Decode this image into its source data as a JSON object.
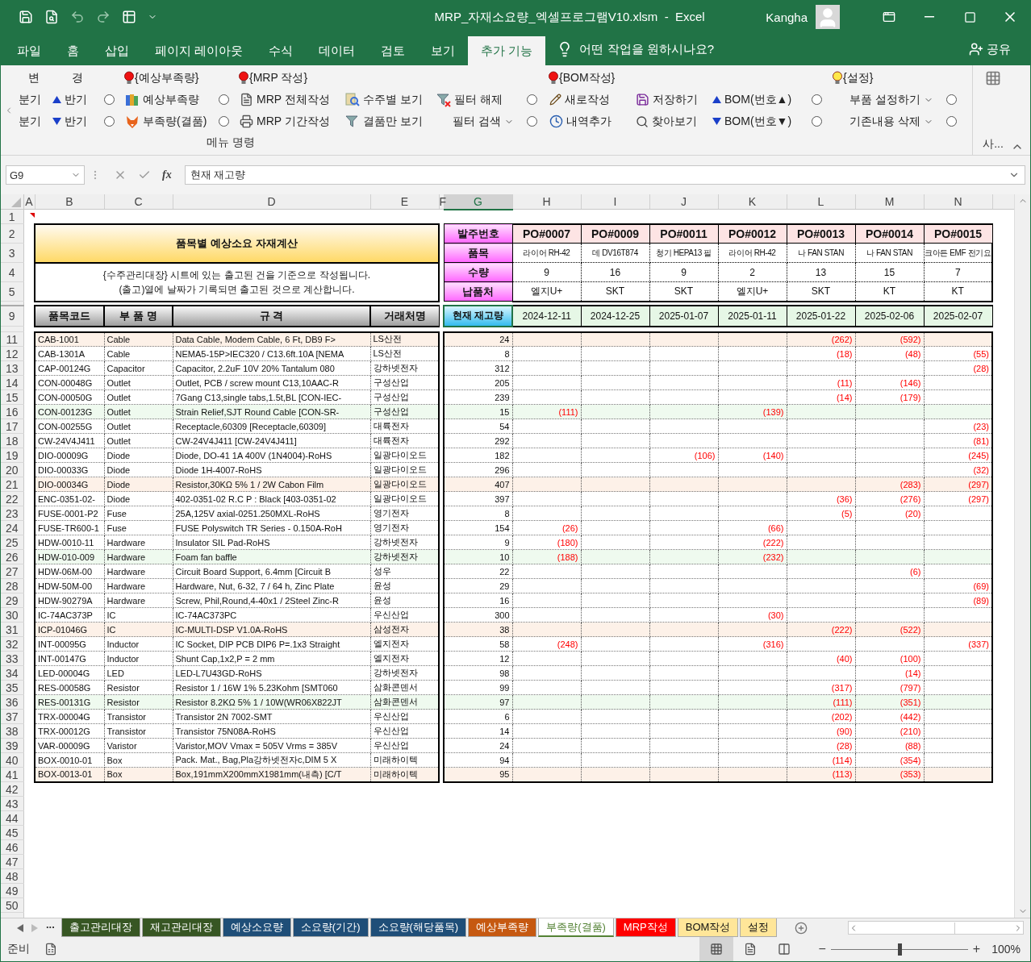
{
  "window": {
    "title": "MRP_자재소요량_엑셀프로그램V10.xlsm  -  Excel",
    "user": "Kangha"
  },
  "menu_tabs": [
    {
      "label": "파일",
      "selected": false
    },
    {
      "label": "홈",
      "selected": false
    },
    {
      "label": "삽입",
      "selected": false
    },
    {
      "label": "페이지 레이아웃",
      "selected": false
    },
    {
      "label": "수식",
      "selected": false
    },
    {
      "label": "데이터",
      "selected": false
    },
    {
      "label": "검토",
      "selected": false
    },
    {
      "label": "보기",
      "selected": false
    },
    {
      "label": "추가 기능",
      "selected": true
    }
  ],
  "tell_me": "어떤 작업을 원하시나요?",
  "share": "공유",
  "ribbon": {
    "columns": [
      {
        "header": {
          "label": "변",
          "kind": "plain"
        },
        "buttons": [
          {
            "label": "분기",
            "kind": "plain"
          },
          {
            "label": "분기",
            "kind": "plain"
          }
        ]
      },
      {
        "header": {
          "label": "경",
          "kind": "plain"
        },
        "buttons": [
          {
            "label": "반기",
            "kind": "up"
          },
          {
            "label": "반기",
            "kind": "down"
          }
        ]
      },
      {
        "buttons": [
          {
            "kind": "radio",
            "checked": false
          },
          {
            "kind": "radio",
            "checked": false
          }
        ]
      },
      {
        "header": {
          "label": "{예상부족량}",
          "kind": "bulb-red"
        },
        "buttons": [
          {
            "label": "예상부족량",
            "kind": "books"
          },
          {
            "label": "부족량(결품)",
            "kind": "fox"
          }
        ]
      },
      {
        "buttons": [
          {
            "kind": "radio",
            "checked": false
          },
          {
            "kind": "radio",
            "checked": false
          }
        ]
      },
      {
        "header": {
          "label": "{MRP 작성}",
          "kind": "bulb-red"
        },
        "buttons": [
          {
            "label": "MRP 전체작성",
            "kind": "doc"
          },
          {
            "label": "MRP 기간작성",
            "kind": "print"
          }
        ]
      },
      {
        "buttons": [
          {
            "label": "수주별 보기",
            "kind": "find"
          },
          {
            "label": "결품만 보기",
            "kind": "filter"
          }
        ]
      },
      {
        "buttons": [
          {
            "label": "필터 해제",
            "kind": "filter-x"
          },
          {
            "label": "필터 검색",
            "kind": "dropdown"
          }
        ]
      },
      {
        "buttons": [
          {
            "kind": "radio",
            "checked": false
          },
          {
            "kind": "radio",
            "checked": false
          }
        ]
      },
      {
        "header": {
          "label": "{BOM작성}",
          "kind": "bulb-red"
        },
        "buttons": [
          {
            "label": "새로작성",
            "kind": "pencil"
          },
          {
            "label": "내역추가",
            "kind": "clock"
          }
        ]
      },
      {
        "buttons": [
          {
            "label": "저장하기",
            "kind": "save"
          },
          {
            "label": "찾아보기",
            "kind": "search"
          }
        ]
      },
      {
        "buttons": [
          {
            "label": "BOM(번호▲)",
            "kind": "up"
          },
          {
            "label": "BOM(번호▼)",
            "kind": "down"
          }
        ]
      },
      {
        "buttons": [
          {
            "kind": "radio",
            "checked": false
          },
          {
            "kind": "radio",
            "checked": false
          }
        ]
      },
      {
        "header": {
          "label": "{설정}",
          "kind": "bulb-yellow"
        },
        "buttons": [
          {
            "label": "부품 설정하기",
            "kind": "dropdown"
          },
          {
            "label": "기존내용 삭제",
            "kind": "dropdown"
          }
        ]
      },
      {
        "buttons": [
          {
            "kind": "radio",
            "checked": false
          },
          {
            "kind": "radio",
            "checked": false
          }
        ]
      }
    ],
    "group_label": "메뉴 명령",
    "side_label": "사..."
  },
  "formula_bar": {
    "name_box": "G9",
    "fx": "fx",
    "value": "현재 재고량"
  },
  "column_headers": [
    {
      "label": "A",
      "selected": false
    },
    {
      "label": "B",
      "selected": false
    },
    {
      "label": "C",
      "selected": false
    },
    {
      "label": "D",
      "selected": false
    },
    {
      "label": "E",
      "selected": false
    },
    {
      "label": "F",
      "selected": false
    },
    {
      "label": "G",
      "selected": true
    },
    {
      "label": "H",
      "selected": false
    },
    {
      "label": "I",
      "selected": false
    },
    {
      "label": "J",
      "selected": false
    },
    {
      "label": "K",
      "selected": false
    },
    {
      "label": "L",
      "selected": false
    },
    {
      "label": "M",
      "selected": false
    },
    {
      "label": "N",
      "selected": false
    }
  ],
  "row_numbers": [
    "1",
    "2",
    "3",
    "4",
    "5",
    "9",
    "11",
    "12",
    "13",
    "14",
    "15",
    "16",
    "17",
    "18",
    "19",
    "20",
    "21",
    "22",
    "23",
    "24",
    "25",
    "26",
    "27",
    "28",
    "29",
    "30",
    "31",
    "32",
    "33",
    "34",
    "35",
    "36",
    "37",
    "38",
    "39",
    "40",
    "41",
    "42",
    "43",
    "44",
    "45",
    "46",
    "47",
    "48",
    "49",
    "50"
  ],
  "sheet": {
    "title": "품목별 예상소요 자재계산",
    "notes": [
      "{수주관리대장} 시트에 있는 출고된 건을 기준으로 작성됩니다.",
      "(출고)열에 날짜가 기록되면 출고된 것으로 계산합니다."
    ],
    "order_labels": [
      "발주번호",
      "품목",
      "수량",
      "납품처"
    ],
    "orders": [
      {
        "po": "PO#0007",
        "item": "라이어 RH-42",
        "qty": "9",
        "vendor": "엘지U+",
        "date": "2024-12-11"
      },
      {
        "po": "PO#0009",
        "item": "데 DV16T874",
        "qty": "16",
        "vendor": "SKT",
        "date": "2024-12-25"
      },
      {
        "po": "PO#0011",
        "item": "청기 HEPA13 필",
        "qty": "9",
        "vendor": "SKT",
        "date": "2025-01-07"
      },
      {
        "po": "PO#0012",
        "item": "라이어 RH-42",
        "qty": "2",
        "vendor": "엘지U+",
        "date": "2025-01-11"
      },
      {
        "po": "PO#0013",
        "item": "나 FAN STAN",
        "qty": "13",
        "vendor": "SKT",
        "date": "2025-01-22"
      },
      {
        "po": "PO#0014",
        "item": "나 FAN STAN",
        "qty": "15",
        "vendor": "KT",
        "date": "2025-02-06"
      },
      {
        "po": "PO#0015",
        "item": "크아든 EMF 전기요",
        "qty": "7",
        "vendor": "KT",
        "date": "2025-02-07"
      }
    ],
    "headers": [
      "품목코드",
      "부 품 명",
      "규  격",
      "거래처명"
    ],
    "stock_header": "현재 재고량",
    "rows": [
      {
        "code": "CAB-1001",
        "name": "Cable",
        "spec": "Data Cable, Modem Cable, 6 Ft, DB9 F>",
        "vendor": "LS산전",
        "stock": "24",
        "shortages": {
          "L": "(262)",
          "M": "(592)"
        }
      },
      {
        "code": "CAB-1301A",
        "name": "Cable",
        "spec": "NEMA5-15P>IEC320 / C13.6ft.10A [NEMA",
        "vendor": "LS산전",
        "stock": "8",
        "shortages": {
          "L": "(18)",
          "M": "(48)",
          "N": "(55)"
        }
      },
      {
        "code": "CAP-00124G",
        "name": "Capacitor",
        "spec": "Capacitor, 2.2uF 10V 20% Tantalum 080",
        "vendor": "강하넷전자",
        "stock": "312",
        "shortages": {
          "N": "(28)"
        }
      },
      {
        "code": "CON-00048G",
        "name": "Outlet",
        "spec": "Outlet, PCB / screw mount C13,10AAC-R",
        "vendor": "구성산업",
        "stock": "205",
        "shortages": {
          "L": "(11)",
          "M": "(146)"
        }
      },
      {
        "code": "CON-00050G",
        "name": "Outlet",
        "spec": "7Gang C13,single tabs,1.5t,BL [CON-IEC-",
        "vendor": "구성산업",
        "stock": "239",
        "shortages": {
          "L": "(14)",
          "M": "(179)"
        }
      },
      {
        "code": "CON-00123G",
        "name": "Outlet",
        "spec": "Strain Relief,SJT Round Cable [CON-SR-",
        "vendor": "구성산업",
        "stock": "15",
        "shortages": {
          "H": "(111)",
          "K": "(139)"
        }
      },
      {
        "code": "CON-00255G",
        "name": "Outlet",
        "spec": "Receptacle,60309 [Receptacle,60309]",
        "vendor": "대륙전자",
        "stock": "54",
        "shortages": {
          "N": "(23)"
        }
      },
      {
        "code": "CW-24V4J411",
        "name": "Outlet",
        "spec": "CW-24V4J411 [CW-24V4J411]",
        "vendor": "대륙전자",
        "stock": "292",
        "shortages": {
          "N": "(81)"
        }
      },
      {
        "code": "DIO-00009G",
        "name": "Diode",
        "spec": "Diode, DO-41 1A 400V (1N4004)-RoHS",
        "vendor": "일광다이오드",
        "stock": "182",
        "shortages": {
          "J": "(106)",
          "K": "(140)",
          "N": "(245)"
        }
      },
      {
        "code": "DIO-00033G",
        "name": "Diode",
        "spec": "Diode 1H-4007-RoHS",
        "vendor": "일광다이오드",
        "stock": "296",
        "shortages": {
          "N": "(32)"
        }
      },
      {
        "code": "DIO-00034G",
        "name": "Diode",
        "spec": "Resistor,30KΩ 5% 1 / 2W Cabon Film",
        "vendor": "일광다이오드",
        "stock": "407",
        "shortages": {
          "M": "(283)",
          "N": "(297)"
        }
      },
      {
        "code": "ENC-0351-02-",
        "name": "Diode",
        "spec": "402-0351-02 R.C P : Black [403-0351-02",
        "vendor": "일광다이오드",
        "stock": "397",
        "shortages": {
          "L": "(36)",
          "M": "(276)",
          "N": "(297)"
        }
      },
      {
        "code": "FUSE-0001-P2",
        "name": "Fuse",
        "spec": "25A,125V axial-0251.250MXL-RoHS",
        "vendor": "영기전자",
        "stock": "8",
        "shortages": {
          "L": "(5)",
          "M": "(20)"
        }
      },
      {
        "code": "FUSE-TR600-1",
        "name": "Fuse",
        "spec": "FUSE Polyswitch TR Series - 0.150A-RoH",
        "vendor": "영기전자",
        "stock": "154",
        "shortages": {
          "H": "(26)",
          "K": "(66)"
        }
      },
      {
        "code": "HDW-0010-11",
        "name": "Hardware",
        "spec": "Insulator SIL Pad-RoHS",
        "vendor": "강하넷전자",
        "stock": "9",
        "shortages": {
          "H": "(180)",
          "K": "(222)"
        }
      },
      {
        "code": "HDW-010-009",
        "name": "Hardware",
        "spec": "Foam fan baffle",
        "vendor": "강하넷전자",
        "stock": "10",
        "shortages": {
          "H": "(188)",
          "K": "(232)"
        }
      },
      {
        "code": "HDW-06M-00",
        "name": "Hardware",
        "spec": "Circuit Board Support, 6.4mm [Circuit B",
        "vendor": "성우",
        "stock": "22",
        "shortages": {
          "M": "(6)"
        }
      },
      {
        "code": "HDW-50M-00",
        "name": "Hardware",
        "spec": "Hardware, Nut, 6-32, 7 / 64 h, Zinc Plate",
        "vendor": "윤성",
        "stock": "29",
        "shortages": {
          "N": "(69)"
        }
      },
      {
        "code": "HDW-90279A",
        "name": "Hardware",
        "spec": "Screw, Phil,Round,4-40x1 / 2Steel Zinc-R",
        "vendor": "윤성",
        "stock": "16",
        "shortages": {
          "N": "(89)"
        }
      },
      {
        "code": "IC-74AC373P",
        "name": "IC",
        "spec": "IC-74AC373PC",
        "vendor": "우신산업",
        "stock": "300",
        "shortages": {
          "K": "(30)"
        }
      },
      {
        "code": "ICP-01046G",
        "name": "IC",
        "spec": "IC-MULTI-DSP V1.0A-RoHS",
        "vendor": "삼성전자",
        "stock": "38",
        "shortages": {
          "L": "(222)",
          "M": "(522)"
        }
      },
      {
        "code": "INT-00095G",
        "name": "Inductor",
        "spec": "IC Socket, DIP PCB DIP6 P=.1x3 Straight",
        "vendor": "엘지전자",
        "stock": "58",
        "shortages": {
          "H": "(248)",
          "K": "(316)",
          "N": "(337)"
        }
      },
      {
        "code": "INT-00147G",
        "name": "Inductor",
        "spec": "Shunt Cap,1x2,P = 2 mm",
        "vendor": "엘지전자",
        "stock": "12",
        "shortages": {
          "L": "(40)",
          "M": "(100)"
        }
      },
      {
        "code": "LED-00004G",
        "name": "LED",
        "spec": "LED-L7U43GD-RoHS",
        "vendor": "강하넷전자",
        "stock": "98",
        "shortages": {
          "M": "(14)"
        }
      },
      {
        "code": "RES-00058G",
        "name": "Resistor",
        "spec": "Resistor 1 / 16W 1% 5.23Kohm [SMT060",
        "vendor": "삼화콘덴서",
        "stock": "99",
        "shortages": {
          "L": "(317)",
          "M": "(797)"
        }
      },
      {
        "code": "RES-00131G",
        "name": "Resistor",
        "spec": "Resistor 8.2KΩ 5% 1 / 10W(WR06X822JT",
        "vendor": "삼화콘덴서",
        "stock": "97",
        "shortages": {
          "L": "(111)",
          "M": "(351)"
        }
      },
      {
        "code": "TRX-00004G",
        "name": "Transistor",
        "spec": "Transistor 2N 7002-SMT",
        "vendor": "우신산업",
        "stock": "6",
        "shortages": {
          "L": "(202)",
          "M": "(442)"
        }
      },
      {
        "code": "TRX-00012G",
        "name": "Transistor",
        "spec": "Transistor 75N08A-RoHS",
        "vendor": "우신산업",
        "stock": "14",
        "shortages": {
          "L": "(90)",
          "M": "(210)"
        }
      },
      {
        "code": "VAR-00009G",
        "name": "Varistor",
        "spec": "Varistor,MOV Vmax = 505V Vrms = 385V",
        "vendor": "우신산업",
        "stock": "24",
        "shortages": {
          "L": "(28)",
          "M": "(88)"
        }
      },
      {
        "code": "BOX-0010-01",
        "name": "Box",
        "spec": "Pack. Mat., Bag,Pla강하넷전자c,DIM 5 X",
        "vendor": "미래하이텍",
        "stock": "94",
        "shortages": {
          "L": "(114)",
          "M": "(354)"
        }
      },
      {
        "code": "BOX-0013-01",
        "name": "Box",
        "spec": "Box,191mmX200mmX1981mm(내측) [C/T",
        "vendor": "미래하이텍",
        "stock": "95",
        "shortages": {
          "L": "(113)",
          "M": "(353)"
        }
      }
    ]
  },
  "sheet_tabs_more": "...",
  "sheet_tabs": [
    {
      "label": "출고관리대장",
      "color": "#375623",
      "selected": false
    },
    {
      "label": "재고관리대장",
      "color": "#375623",
      "selected": false
    },
    {
      "label": "예상소요량",
      "color": "#1f4e78",
      "selected": false
    },
    {
      "label": "소요량(기간)",
      "color": "#1f4e78",
      "selected": false
    },
    {
      "label": "소요량(해당품목)",
      "color": "#1f4e78",
      "selected": false
    },
    {
      "label": "예상부족량",
      "color": "#c65911",
      "selected": false
    },
    {
      "label": "부족량(결품)",
      "color": "#548235",
      "selected": true
    },
    {
      "label": "MRP작성",
      "color": "#ff0000",
      "selected": false
    },
    {
      "label": "BOM작성",
      "color": "#ffe699",
      "selected": false
    },
    {
      "label": "설정",
      "color": "#ffe699",
      "selected": false
    }
  ],
  "status": {
    "ready": "준비",
    "views": [
      {
        "kind": "normal",
        "selected": true
      },
      {
        "kind": "page-layout",
        "selected": false
      },
      {
        "kind": "page-break",
        "selected": false
      }
    ],
    "zoom": {
      "minus": "−",
      "plus": "+",
      "level": 0.5,
      "reading": "100%"
    }
  }
}
